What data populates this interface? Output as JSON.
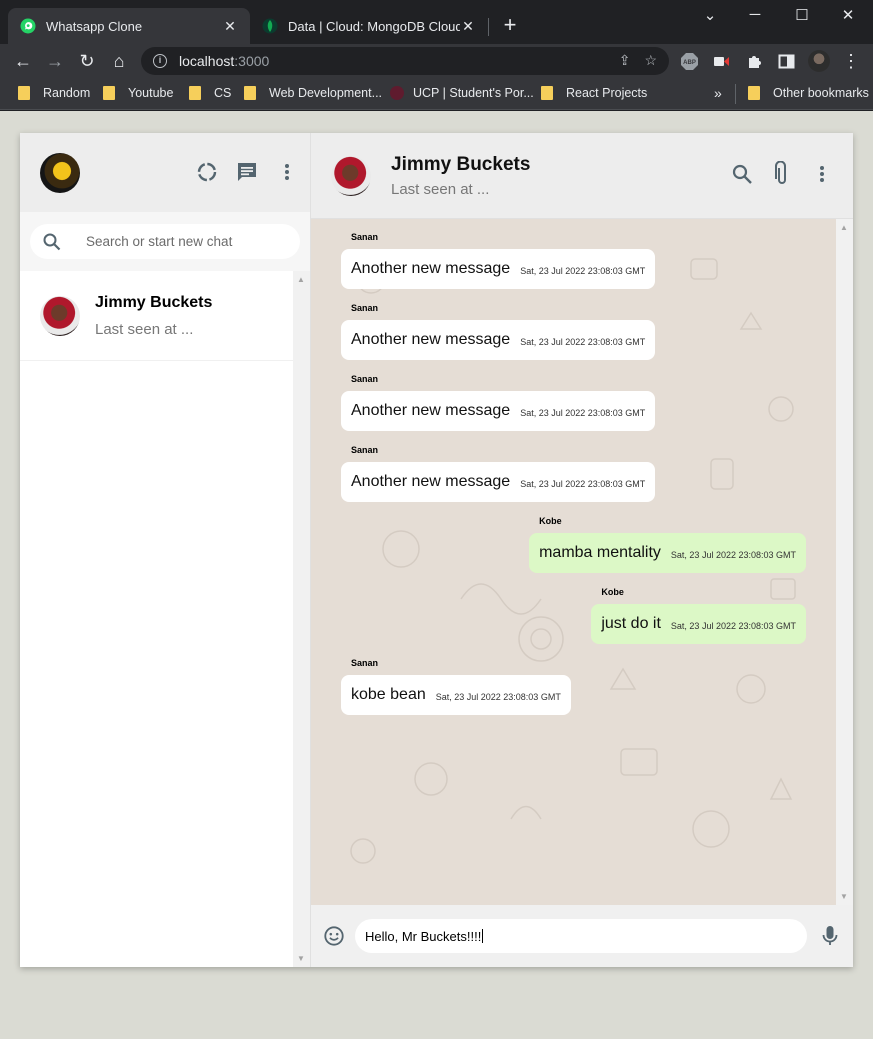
{
  "browser": {
    "tabs": [
      {
        "title": "Whatsapp Clone",
        "active": true
      },
      {
        "title": "Data | Cloud: MongoDB Cloud",
        "active": false
      }
    ],
    "url_host": "localhost",
    "url_port": ":3000",
    "bookmarks": [
      "Random",
      "Youtube",
      "CS",
      "Web Development...",
      "UCP | Student's Por...",
      "React Projects"
    ],
    "other_bookmarks": "Other bookmarks",
    "overflow_chevron": "»",
    "ext_abp": "ABP"
  },
  "sidebar": {
    "search_placeholder": "Search or start new chat",
    "chats": [
      {
        "name": "Jimmy Buckets",
        "subtitle": "Last seen at ..."
      }
    ]
  },
  "chat": {
    "header": {
      "name": "Jimmy Buckets",
      "subtitle": "Last seen at ..."
    },
    "messages": [
      {
        "sender": "Sanan",
        "text": "Another new message",
        "time": "Sat, 23 Jul 2022 23:08:03 GMT",
        "outgoing": false
      },
      {
        "sender": "Sanan",
        "text": "Another new message",
        "time": "Sat, 23 Jul 2022 23:08:03 GMT",
        "outgoing": false
      },
      {
        "sender": "Sanan",
        "text": "Another new message",
        "time": "Sat, 23 Jul 2022 23:08:03 GMT",
        "outgoing": false
      },
      {
        "sender": "Sanan",
        "text": "Another new message",
        "time": "Sat, 23 Jul 2022 23:08:03 GMT",
        "outgoing": false
      },
      {
        "sender": "Kobe",
        "text": "mamba mentality",
        "time": "Sat, 23 Jul 2022 23:08:03 GMT",
        "outgoing": true
      },
      {
        "sender": "Kobe",
        "text": "just do it",
        "time": "Sat, 23 Jul 2022 23:08:03 GMT",
        "outgoing": true
      },
      {
        "sender": "Sanan",
        "text": "kobe bean",
        "time": "Sat, 23 Jul 2022 23:08:03 GMT",
        "outgoing": false
      }
    ],
    "composer_value": "Hello, Mr Buckets!!!!"
  },
  "colors": {
    "incoming_bubble": "#ffffff",
    "outgoing_bubble": "#dcf8c6",
    "chat_background": "#e5ddd5",
    "page_background": "#dadbd3"
  },
  "icons": {
    "status": "status-ring-icon",
    "new_chat": "chat-bubble-icon",
    "menu": "more-vertical-icon",
    "search": "search-icon",
    "attach": "paperclip-icon",
    "emoji": "emoji-icon",
    "mic": "microphone-icon"
  }
}
